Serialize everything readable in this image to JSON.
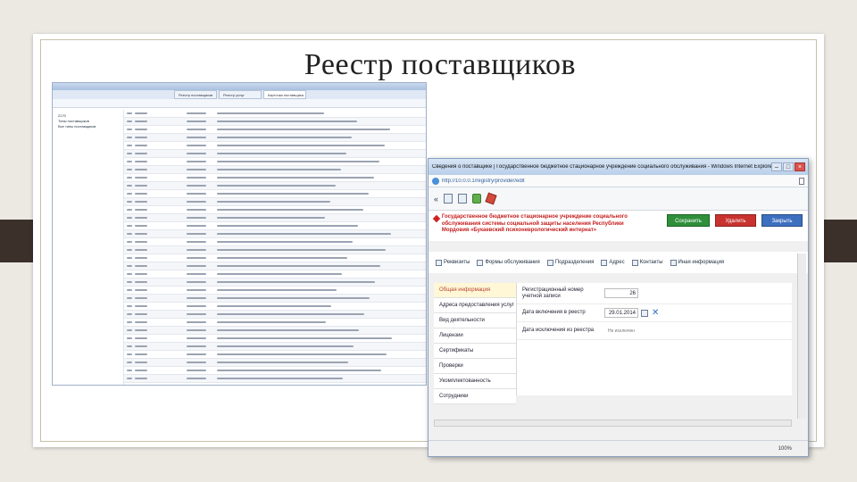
{
  "slide": {
    "title": "Реестр поставщиков"
  },
  "background_window": {
    "tabs": [
      "Реестр поставщиков",
      "Реестр услуг",
      "Карточка поставщика"
    ],
    "tree": [
      "2170",
      "Типы поставщиков",
      "Все типы поставщиков"
    ]
  },
  "main_window": {
    "title": "Сведения о поставщике | Государственное бюджетное стационарное учреждение социального обслуживания - Windows Internet Explorer",
    "address": "http://10.0.0.1/registry/provider/edit",
    "organization": "Государственное бюджетное стационарное учреждение социального обслуживания системы социальной защиты населения Республики Мордовия «Букаевский психоневрологический интернат»",
    "buttons": {
      "save": "Сохранить",
      "delete": "Удалить",
      "close": "Закрыть"
    },
    "tabs": [
      "Реквизиты",
      "Формы обслуживания",
      "Подразделения",
      "Адрес",
      "Контакты",
      "Иная информация"
    ],
    "nav_items": [
      "Общая информация",
      "Адреса предоставления услуг",
      "Вид деятельности",
      "Лицензии",
      "Сертификаты",
      "Проверки",
      "Укомплектованность",
      "Сотрудники"
    ],
    "active_nav": "Общая информация",
    "form": {
      "reg_number_label": "Регистрационный номер учетной записи",
      "reg_number_value": "26",
      "included_label": "Дата включения в реестр",
      "included_value": "29.01.2014",
      "excluded_label": "Дата исключения из реестра",
      "excluded_note": "Не исключен"
    },
    "status_zoom": "100%"
  }
}
